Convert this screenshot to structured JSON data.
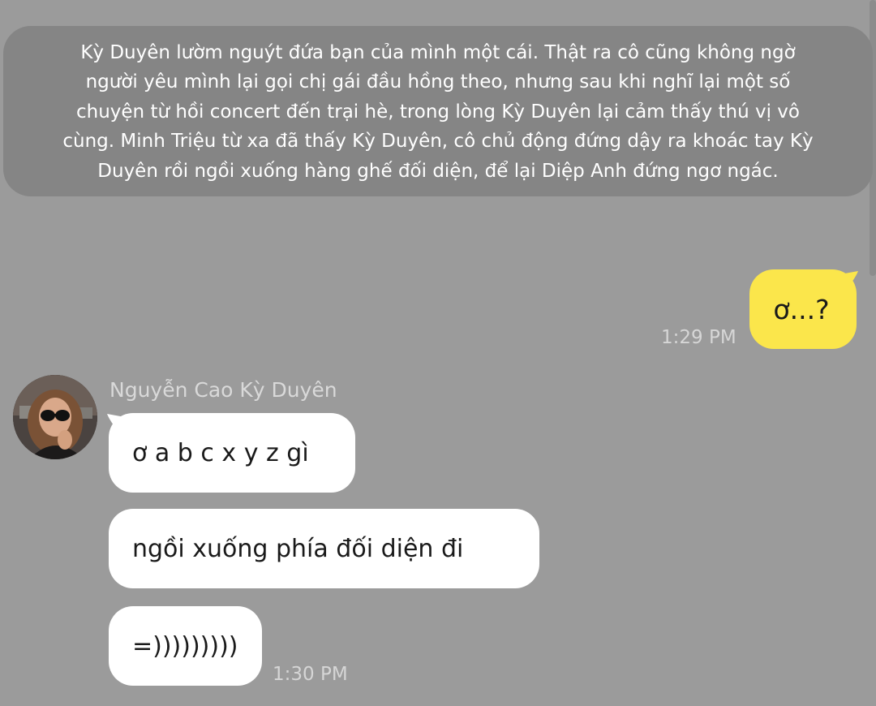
{
  "notice": {
    "lines": [
      "Kỳ Duyên lườm nguýt đứa bạn của mình một cái. Thật ra cô cũng không ngờ",
      "người yêu mình lại gọi chị gái đầu hồng theo, nhưng sau khi nghĩ lại một số",
      "chuyện từ hồi concert đến trại hè, trong lòng Kỳ Duyên lại cảm thấy thú vị vô",
      "cùng. Minh Triệu từ xa đã thấy Kỳ Duyên, cô chủ động đứng dậy ra khoác tay Kỳ",
      "Duyên rồi ngồi xuống hàng ghế đối diện, để lại Diệp Anh đứng ngơ ngác."
    ]
  },
  "sent": {
    "text": "ơ...?",
    "time": "1:29 PM"
  },
  "received": {
    "sender": "Nguyễn Cao Kỳ Duyên",
    "messages": [
      "ơ a b c x y z gì",
      "ngồi xuống phía đối diện đi",
      "=)))))))))"
    ],
    "time": "1:30 PM"
  },
  "colors": {
    "background": "#9b9b9b",
    "notice_bg": "#858585",
    "sent_bubble": "#fbe64b",
    "received_bubble": "#ffffff"
  },
  "icons": {
    "avatar": "user-avatar-photo"
  }
}
